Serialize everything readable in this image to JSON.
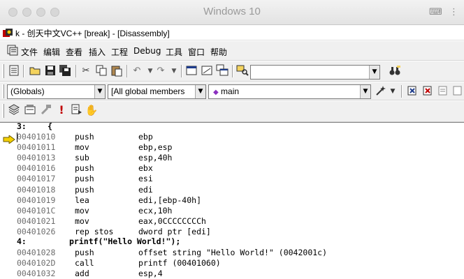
{
  "host": {
    "title": "Windows 10"
  },
  "app": {
    "title": "k - 创天中文VC++ [break] - [Disassembly]"
  },
  "menu": [
    "文件",
    "编辑",
    "查看",
    "插入",
    "工程",
    "Debug",
    "工具",
    "窗口",
    "帮助"
  ],
  "toolbar2": {
    "find_value": ""
  },
  "toolbar3": {
    "class_combo": "(Globals)",
    "members_combo": "[All global members",
    "function_combo": "main"
  },
  "disassembly": {
    "src_lines": [
      {
        "line": "3:",
        "code": "{"
      },
      {
        "line": "4:",
        "code": "printf(\"Hello World!\");"
      }
    ],
    "instructions_a": [
      {
        "addr": "00401010",
        "op": "push",
        "args": "ebp"
      },
      {
        "addr": "00401011",
        "op": "mov",
        "args": "ebp,esp"
      },
      {
        "addr": "00401013",
        "op": "sub",
        "args": "esp,40h"
      },
      {
        "addr": "00401016",
        "op": "push",
        "args": "ebx"
      },
      {
        "addr": "00401017",
        "op": "push",
        "args": "esi"
      },
      {
        "addr": "00401018",
        "op": "push",
        "args": "edi"
      },
      {
        "addr": "00401019",
        "op": "lea",
        "args": "edi,[ebp-40h]"
      },
      {
        "addr": "0040101C",
        "op": "mov",
        "args": "ecx,10h"
      },
      {
        "addr": "00401021",
        "op": "mov",
        "args": "eax,0CCCCCCCCh"
      },
      {
        "addr": "00401026",
        "op": "rep stos",
        "args": "dword ptr [edi]"
      }
    ],
    "instructions_b": [
      {
        "addr": "00401028",
        "op": "push",
        "args": "offset string \"Hello World!\" (0042001c)"
      },
      {
        "addr": "0040102D",
        "op": "call",
        "args": "printf (00401060)"
      },
      {
        "addr": "00401032",
        "op": "add",
        "args": "esp,4"
      }
    ]
  }
}
